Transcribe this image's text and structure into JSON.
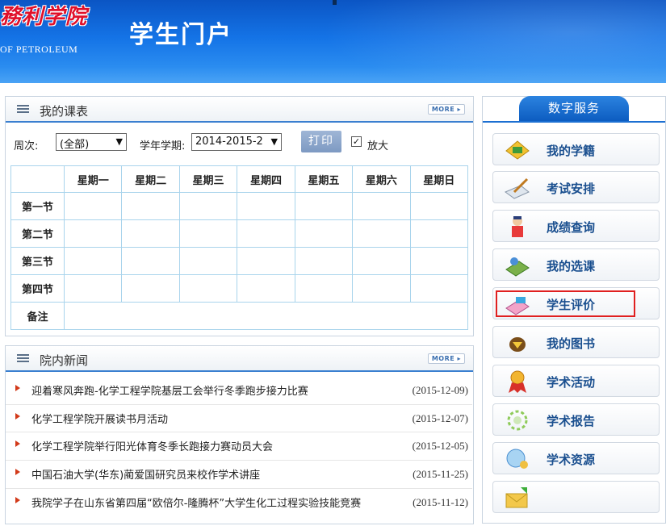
{
  "header": {
    "school_name": "石油大学胜利学院",
    "school_name_visible": "務利学院",
    "school_en": "OF PETROLEUM",
    "portal_title": "学生门户"
  },
  "timetable": {
    "title": "我的课表",
    "more": "MORE ▸",
    "week_label": "周次:",
    "week_value": "(全部)",
    "term_label": "学年学期:",
    "term_value": "2014-2015-2",
    "print_label": "打印",
    "zoom_label": "放大",
    "zoom_checked": true,
    "columns": [
      "",
      "星期一",
      "星期二",
      "星期三",
      "星期四",
      "星期五",
      "星期六",
      "星期日"
    ],
    "rows": [
      "第一节",
      "第二节",
      "第三节",
      "第四节",
      "备注"
    ]
  },
  "news": {
    "title": "院内新闻",
    "more": "MORE ▸",
    "items": [
      {
        "title": "迎着寒风奔跑-化学工程学院基层工会举行冬季跑步接力比赛",
        "date": "(2015-12-09)"
      },
      {
        "title": "化学工程学院开展读书月活动",
        "date": "(2015-12-07)"
      },
      {
        "title": "化学工程学院举行阳光体育冬季长跑接力赛动员大会",
        "date": "(2015-12-05)"
      },
      {
        "title": "中国石油大学(华东)蔺爱国研究员来校作学术讲座",
        "date": "(2015-11-25)"
      },
      {
        "title": "我院学子在山东省第四届“欧倍尔-隆腾杯”大学生化工过程实验技能竞赛",
        "date": "(2015-11-12)"
      }
    ]
  },
  "services": {
    "title": "数字服务",
    "items": [
      {
        "label": "我的学籍",
        "icon": "student-record-icon"
      },
      {
        "label": "考试安排",
        "icon": "exam-schedule-icon"
      },
      {
        "label": "成绩查询",
        "icon": "grade-query-icon"
      },
      {
        "label": "我的选课",
        "icon": "course-selection-icon"
      },
      {
        "label": "学生评价",
        "icon": "student-evaluation-icon"
      },
      {
        "label": "我的图书",
        "icon": "library-books-icon"
      },
      {
        "label": "学术活动",
        "icon": "academic-activity-icon"
      },
      {
        "label": "学术报告",
        "icon": "academic-report-icon"
      },
      {
        "label": "学术资源",
        "icon": "academic-resource-icon"
      },
      {
        "label": "",
        "icon": "mail-icon"
      }
    ]
  },
  "colors": {
    "banner": "#1473e6",
    "accent": "#1c6fd2",
    "highlight": "#e02020",
    "service_label": "#1a4f8f"
  }
}
